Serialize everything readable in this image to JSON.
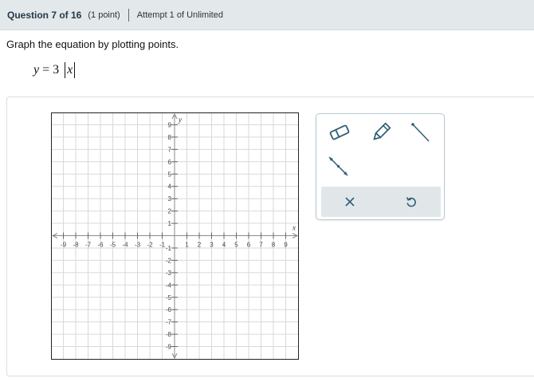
{
  "header": {
    "question": "Question 7 of 16",
    "points": "(1 point)",
    "attempt": "Attempt 1 of Unlimited"
  },
  "prompt": {
    "instruction": "Graph the equation by plotting points.",
    "eq_lhs": "y",
    "eq_mid": " = 3 ",
    "eq_var": "x"
  },
  "graph": {
    "x_label": "x",
    "y_label": "y",
    "x_range": [
      -10,
      10
    ],
    "y_range": [
      -10,
      10
    ],
    "x_ticks": [
      "-9",
      "-8",
      "-7",
      "-6",
      "-5",
      "-4",
      "-3",
      "-2",
      "-1",
      "1",
      "2",
      "3",
      "4",
      "5",
      "6",
      "7",
      "8",
      "9"
    ],
    "y_ticks": [
      "9",
      "8",
      "7",
      "6",
      "5",
      "4",
      "3",
      "2",
      "1",
      "-1",
      "-2",
      "-3",
      "-4",
      "-5",
      "-6",
      "-7",
      "-8",
      "-9"
    ],
    "grid_color": "#d9d9d9",
    "axis_color": "#8a8a8a"
  },
  "toolbox": {
    "tools": [
      {
        "name": "eraser-icon"
      },
      {
        "name": "pencil-icon"
      },
      {
        "name": "line-segment-icon"
      },
      {
        "name": "ray-line-icon"
      }
    ],
    "actions": [
      {
        "name": "clear-icon"
      },
      {
        "name": "undo-icon"
      }
    ],
    "accent": "#2f5d75"
  }
}
